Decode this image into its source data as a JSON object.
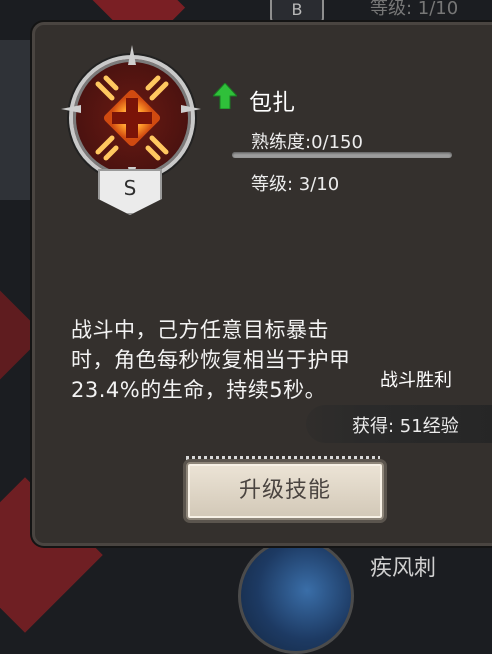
{
  "background": {
    "rank_badge_letter": "B",
    "top_level_text": "等级: 1/10",
    "bottom_skill_name": "疾风刺"
  },
  "tooltip": {
    "skill_icon": "bandage-cross-icon",
    "rank_letter": "S",
    "upgrade_available_icon": "green-up-arrow-icon",
    "skill_name": "包扎",
    "proficiency_label": "熟练度:0/150",
    "proficiency_fraction": 0.0,
    "level_label": "等级: 3/10",
    "description": [
      "战斗中，己方任意目标暴击",
      "时，角色每秒恢复相当于护甲",
      "23.4%的生命，持续5秒。"
    ],
    "upgrade_button_label": "升级技能"
  },
  "victory_popup": {
    "title": "战斗胜利",
    "reward_text": "获得: 51经验"
  },
  "colors": {
    "panel_bg": "#34302d",
    "accent_green": "#2fc03a",
    "icon_red": "#6a1a12"
  }
}
